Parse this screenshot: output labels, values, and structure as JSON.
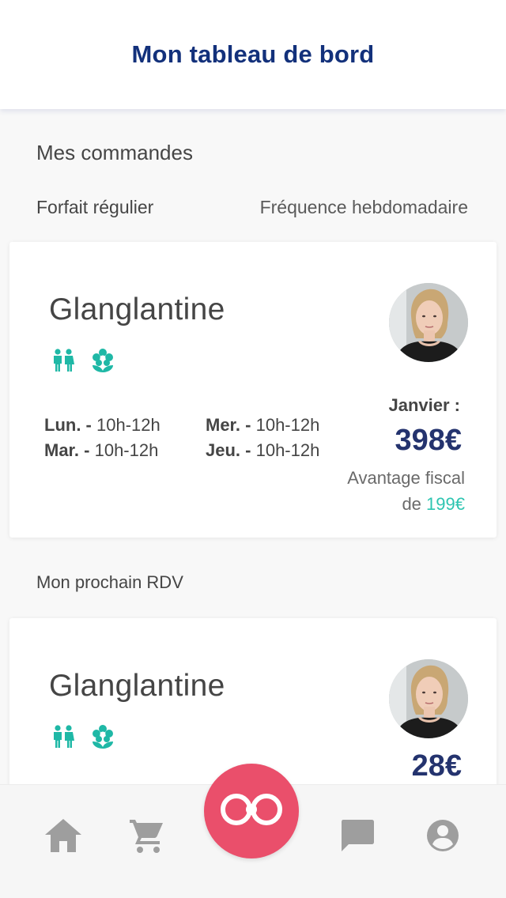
{
  "header": {
    "title": "Mon tableau de bord"
  },
  "orders": {
    "title": "Mes commandes",
    "plan_label": "Forfait régulier",
    "frequency_label": "Fréquence hebdomadaire"
  },
  "order_card": {
    "name": "Glanglantine",
    "icons": [
      "children-icon",
      "flower-icon"
    ],
    "schedule": [
      {
        "day": "Lun. -",
        "hours": "10h-12h"
      },
      {
        "day": "Mar. -",
        "hours": "10h-12h"
      },
      {
        "day": "Mer. -",
        "hours": "10h-12h"
      },
      {
        "day": "Jeu. -",
        "hours": "10h-12h"
      }
    ],
    "month_label": "Janvier :",
    "price": "398€",
    "fiscal_text": "Avantage fiscal",
    "fiscal_prefix": "de",
    "fiscal_amount": "199€"
  },
  "next_appointment": {
    "title": "Mon prochain RDV",
    "name": "Glanglantine",
    "icons": [
      "children-icon",
      "flower-icon"
    ],
    "price": "28€"
  },
  "tabbar": {
    "items": [
      "home-icon",
      "cart-icon",
      "logo-button",
      "chat-icon",
      "account-icon"
    ]
  },
  "colors": {
    "brand_navy": "#13317b",
    "price_navy": "#24336e",
    "accent_teal": "#2ec5b1",
    "fab_pink": "#ea4f6b",
    "tab_gray": "#9e9e9e"
  }
}
